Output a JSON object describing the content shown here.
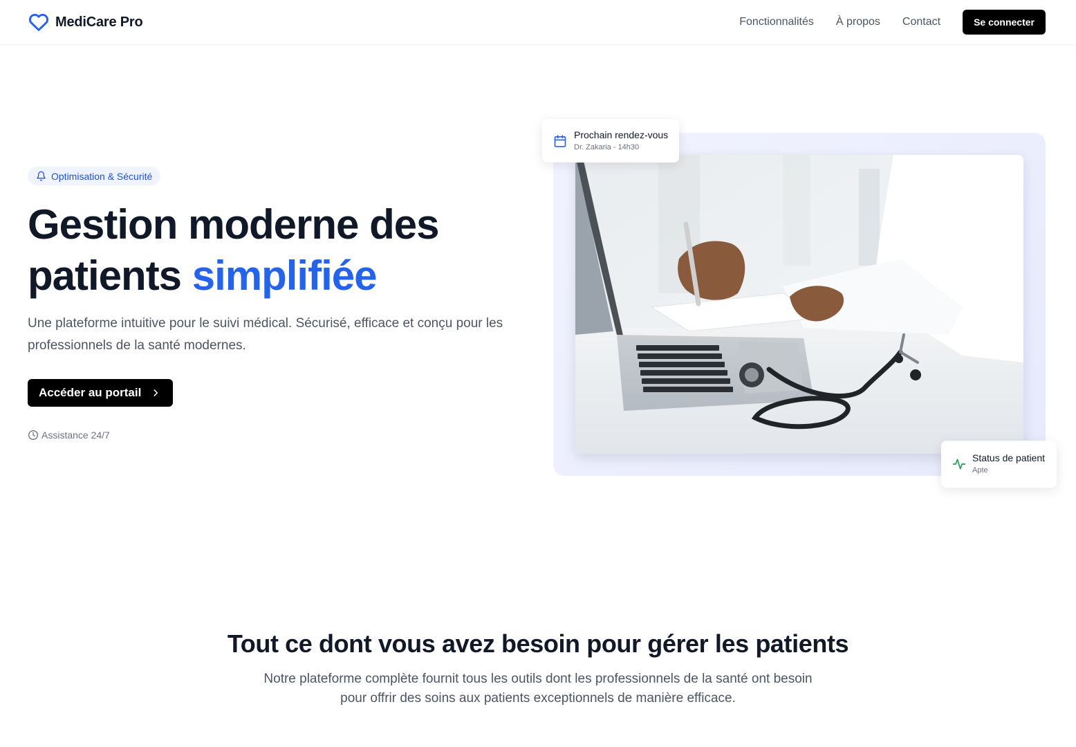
{
  "nav": {
    "brand": "MediCare Pro",
    "links": [
      "Fonctionnalités",
      "À propos",
      "Contact"
    ],
    "login_label": "Se connecter"
  },
  "hero": {
    "badge": "Optimisation & Sécurité",
    "title_line1": "Gestion moderne des",
    "title_line2_plain": "patients ",
    "title_line2_accent": "simplifiée",
    "subtitle": "Une plateforme intuitive pour le suivi médical. Sécurisé, efficace et conçu pour les professionnels de la santé modernes.",
    "cta_label": "Accéder au portail",
    "assistance": "Assistance 24/7"
  },
  "cards": {
    "appointment": {
      "title": "Prochain rendez-vous",
      "subtitle": "Dr. Zakaria - 14h30"
    },
    "status": {
      "title": "Status de patient",
      "subtitle": "Apte"
    }
  },
  "features": {
    "title": "Tout ce dont vous avez besoin pour gérer les patients",
    "subtitle": "Notre plateforme complète fournit tous les outils dont les professionnels de la santé ont besoin pour offrir des soins aux patients exceptionnels de manière efficace."
  },
  "icons": {
    "brand": "heart-icon",
    "badge": "bell-icon",
    "cta": "chevron-right-icon",
    "assistance": "clock-icon",
    "appointment": "calendar-icon",
    "status": "activity-icon"
  },
  "colors": {
    "accent": "#2563eb",
    "status_green": "#16a34a",
    "primary_button": "#000000"
  }
}
